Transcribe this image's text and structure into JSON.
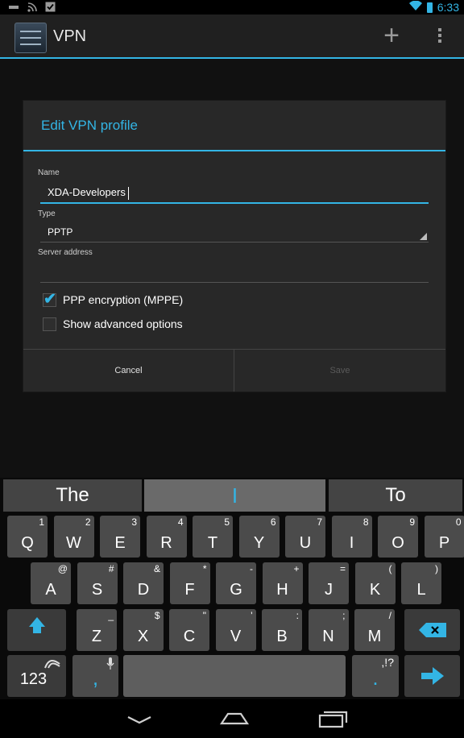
{
  "status_bar": {
    "left_icons": [
      "usb-icon",
      "rss-icon",
      "checkbox-notification-icon"
    ],
    "time": "6:33",
    "right_icons": [
      "wifi-icon",
      "battery-icon"
    ]
  },
  "action_bar": {
    "title": "VPN",
    "add_icon": "plus-icon",
    "overflow_icon": "overflow-menu-icon"
  },
  "dialog": {
    "title": "Edit VPN profile",
    "name_label": "Name",
    "name_value": "XDA-Developers",
    "type_label": "Type",
    "type_value": "PPTP",
    "server_label": "Server address",
    "server_value": "",
    "ppp_label": "PPP encryption (MPPE)",
    "ppp_checked": true,
    "advanced_label": "Show advanced options",
    "advanced_checked": false,
    "cancel_label": "Cancel",
    "save_label": "Save"
  },
  "keyboard": {
    "suggestions": [
      "The",
      "I",
      "To"
    ],
    "row1": [
      {
        "main": "Q",
        "alt": "1"
      },
      {
        "main": "W",
        "alt": "2"
      },
      {
        "main": "E",
        "alt": "3"
      },
      {
        "main": "R",
        "alt": "4"
      },
      {
        "main": "T",
        "alt": "5"
      },
      {
        "main": "Y",
        "alt": "6"
      },
      {
        "main": "U",
        "alt": "7"
      },
      {
        "main": "I",
        "alt": "8"
      },
      {
        "main": "O",
        "alt": "9"
      },
      {
        "main": "P",
        "alt": "0"
      }
    ],
    "row2": [
      {
        "main": "A",
        "alt": "@"
      },
      {
        "main": "S",
        "alt": "#"
      },
      {
        "main": "D",
        "alt": "&"
      },
      {
        "main": "F",
        "alt": "*"
      },
      {
        "main": "G",
        "alt": "-"
      },
      {
        "main": "H",
        "alt": "+"
      },
      {
        "main": "J",
        "alt": "="
      },
      {
        "main": "K",
        "alt": "("
      },
      {
        "main": "L",
        "alt": ")"
      }
    ],
    "row3": [
      {
        "main": "Z",
        "alt": "_"
      },
      {
        "main": "X",
        "alt": "$"
      },
      {
        "main": "C",
        "alt": "\""
      },
      {
        "main": "V",
        "alt": "'"
      },
      {
        "main": "B",
        "alt": ":"
      },
      {
        "main": "N",
        "alt": ";"
      },
      {
        "main": "M",
        "alt": "/"
      }
    ],
    "symbols_label": "123",
    "comma_label": ",",
    "period_label": ".",
    "period_alt": ",!?",
    "accent_color": "#33b5e5"
  },
  "nav_bar": {
    "icons": [
      "back-icon",
      "home-icon",
      "recents-icon"
    ]
  }
}
